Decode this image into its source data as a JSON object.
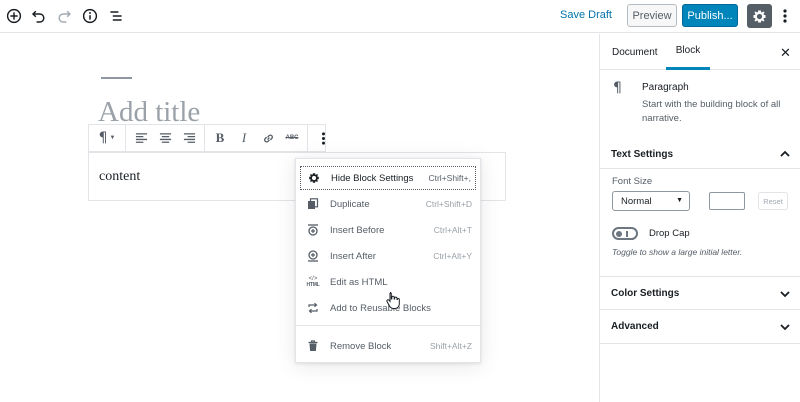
{
  "toolbar": {
    "save_draft": "Save Draft",
    "preview": "Preview",
    "publish": "Publish...",
    "icons": [
      "add-block-icon",
      "undo-icon",
      "redo-icon",
      "info-icon",
      "block-navigation-icon",
      "gear-icon",
      "more-vertical-icon"
    ]
  },
  "editor": {
    "title_placeholder": "Add title",
    "content": "content"
  },
  "block_toolbar": {
    "bold": "B",
    "italic": "I",
    "strikethrough": "ABC",
    "paragraph_symbol": "¶"
  },
  "block_menu": {
    "items": [
      {
        "label": "Hide Block Settings",
        "shortcut": "Ctrl+Shift+,",
        "icon": "gear-icon"
      },
      {
        "label": "Duplicate",
        "shortcut": "Ctrl+Shift+D",
        "icon": "duplicate-icon"
      },
      {
        "label": "Insert Before",
        "shortcut": "Ctrl+Alt+T",
        "icon": "insert-before-icon"
      },
      {
        "label": "Insert After",
        "shortcut": "Ctrl+Alt+Y",
        "icon": "insert-after-icon"
      },
      {
        "label": "Edit as HTML",
        "shortcut": "",
        "icon": "html-icon"
      },
      {
        "label": "Add to Reusable Blocks",
        "shortcut": "",
        "icon": "reusable-icon"
      },
      {
        "label": "Remove Block",
        "shortcut": "Shift+Alt+Z",
        "icon": "trash-icon"
      }
    ],
    "html_icon_text": "HTML"
  },
  "sidebar": {
    "tabs": {
      "document": "Document",
      "block": "Block"
    },
    "close": "✕",
    "block_card": {
      "icon": "¶",
      "title": "Paragraph",
      "description": "Start with the building block of all narrative."
    },
    "text_settings": {
      "title": "Text Settings",
      "font_size_label": "Font Size",
      "font_size_value": "Normal",
      "reset": "Reset",
      "drop_cap_label": "Drop Cap",
      "drop_cap_help": "Toggle to show a large initial letter."
    },
    "color_settings": {
      "title": "Color Settings"
    },
    "advanced": {
      "title": "Advanced"
    }
  },
  "colors": {
    "accent": "#0085ba",
    "link": "#0073aa",
    "text": "#191e23",
    "muted": "#555d66",
    "border": "#e2e4e7"
  }
}
